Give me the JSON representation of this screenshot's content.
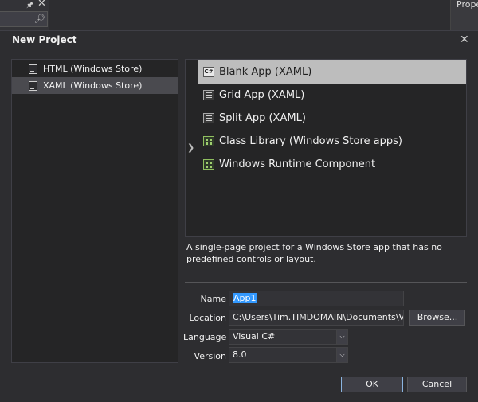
{
  "ide": {
    "right_panel_title": "Prope"
  },
  "dialog": {
    "title": "New Project"
  },
  "tree": {
    "items": [
      {
        "label": "HTML (Windows Store)",
        "selected": false
      },
      {
        "label": "XAML (Windows Store)",
        "selected": true
      }
    ]
  },
  "templates": {
    "items": [
      {
        "label": "Blank App (XAML)",
        "icon": "csharp-icon",
        "selected": true
      },
      {
        "label": "Grid App (XAML)",
        "icon": "grid-app-icon",
        "selected": false
      },
      {
        "label": "Split App (XAML)",
        "icon": "split-app-icon",
        "selected": false
      },
      {
        "label": "Class Library (Windows Store apps)",
        "icon": "class-library-icon",
        "selected": false
      },
      {
        "label": "Windows Runtime Component",
        "icon": "runtime-component-icon",
        "selected": false
      }
    ],
    "selected_icon_text": "C#"
  },
  "description": "A single-page project for a Windows Store app that has no predefined controls or layout.",
  "form": {
    "name_label": "Name",
    "name_value": "App1",
    "location_label": "Location",
    "location_value": "C:\\Users\\Tim.TIMDOMAIN\\Documents\\Visu",
    "browse_label": "Browse...",
    "language_label": "Language",
    "language_value": "Visual C#",
    "version_label": "Version",
    "version_value": "8.0"
  },
  "buttons": {
    "ok": "OK",
    "cancel": "Cancel"
  },
  "colors": {
    "background": "#2d2d30",
    "selection_highlight": "#3399ff",
    "selected_template": "#bdbdbd"
  }
}
